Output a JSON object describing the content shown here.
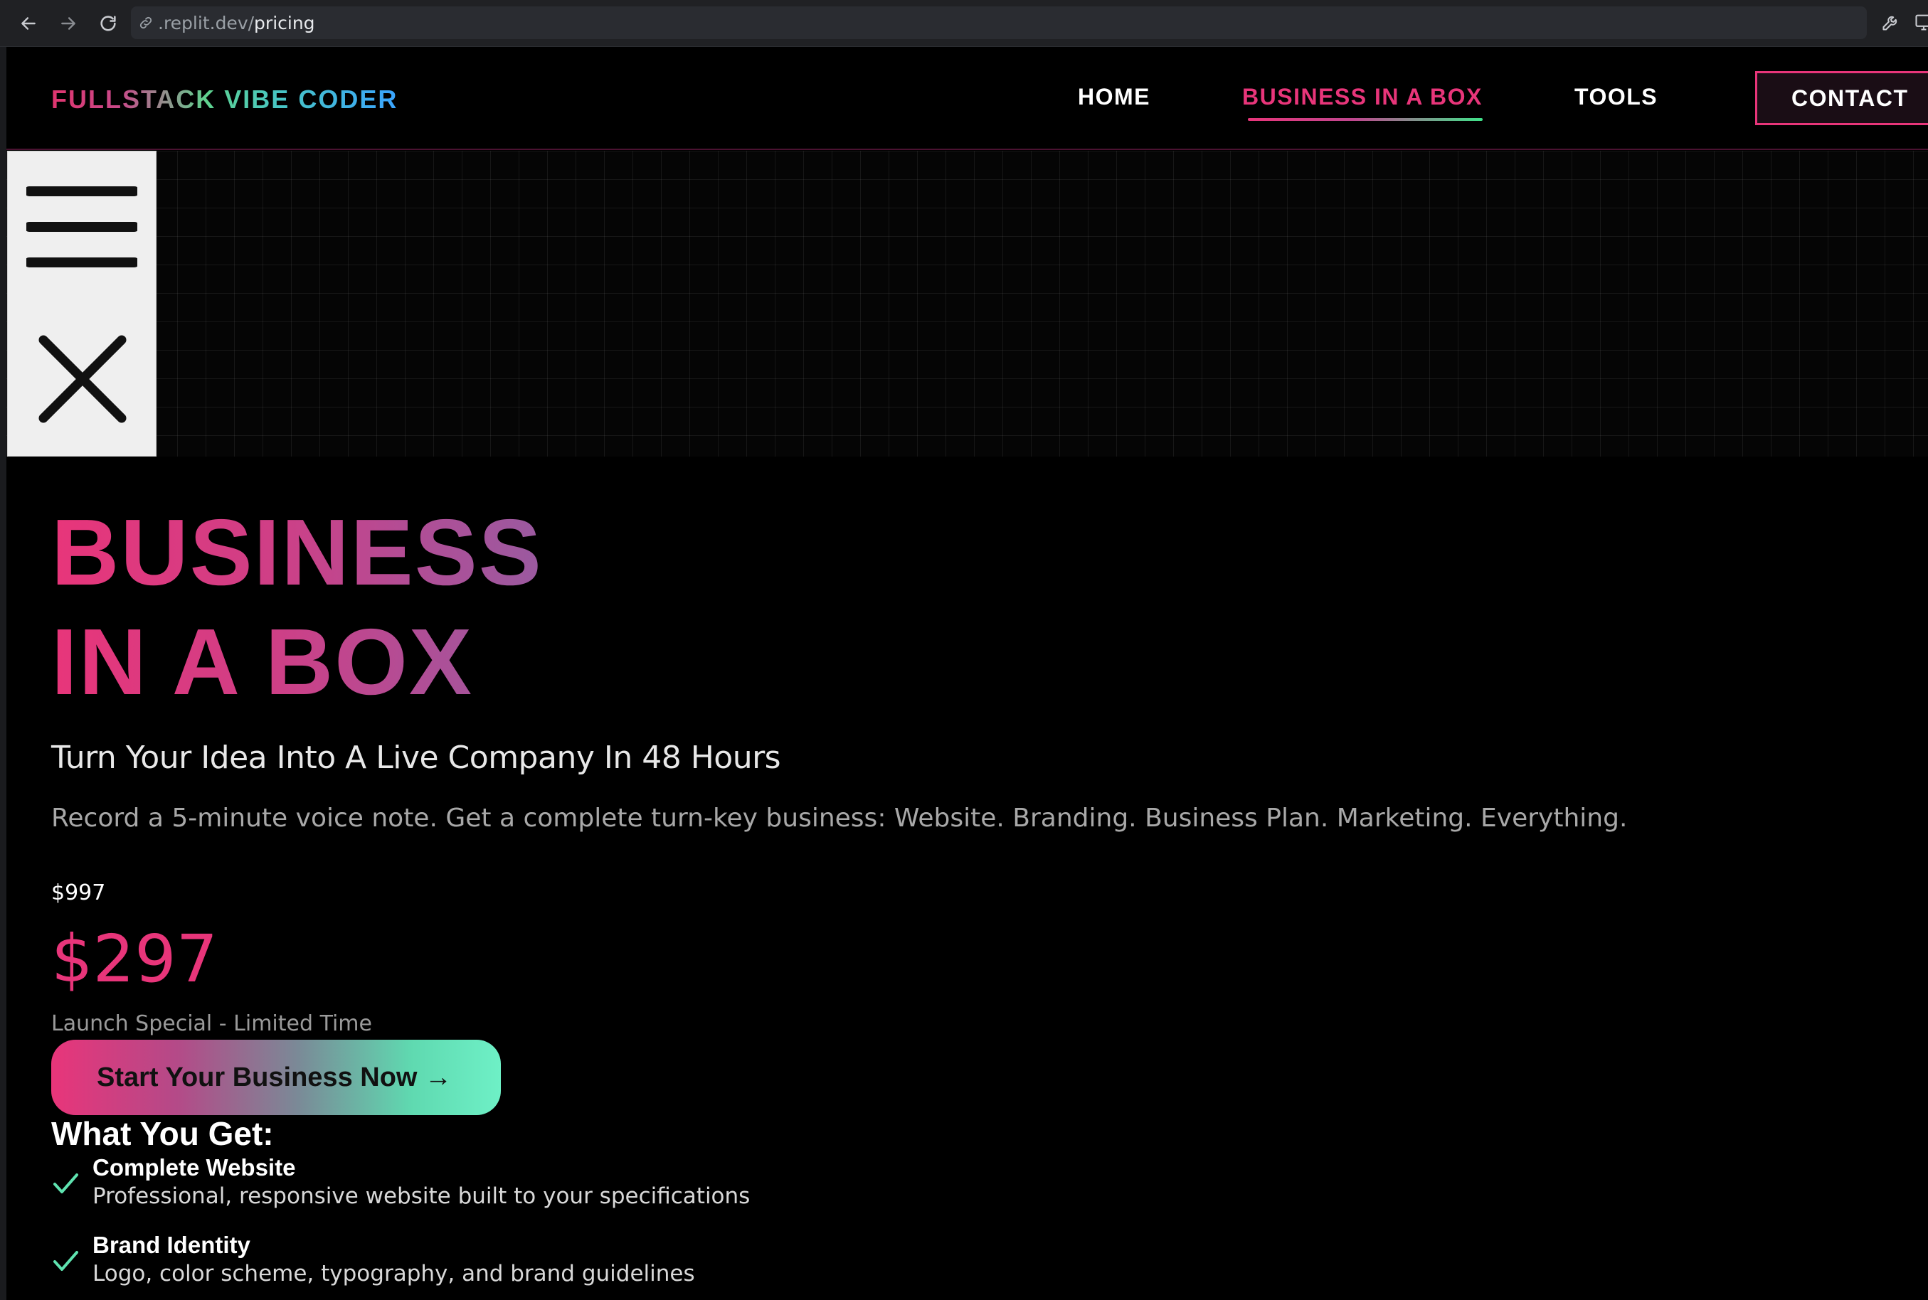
{
  "browser": {
    "url_domain": ".replit.dev/",
    "url_path": "pricing"
  },
  "header": {
    "logo": "FULLSTACK VIBE CODER",
    "nav": [
      {
        "label": "HOME"
      },
      {
        "label": "BUSINESS IN A BOX",
        "active": true
      },
      {
        "label": "TOOLS"
      }
    ],
    "contact_label": "CONTACT"
  },
  "colors": {
    "accent_pink": "#e8357a",
    "accent_green": "#3fe38a",
    "accent_mint": "#6ef0c6",
    "background": "#000000"
  },
  "menu_panel": {
    "icons": [
      "hamburger-icon",
      "close-icon"
    ]
  },
  "hero": {
    "title_line1": "BUSINESS",
    "title_line2": "IN A BOX",
    "tagline": "Turn Your Idea Into A Live Company In 48 Hours",
    "description": "Record a 5-minute voice note. Get a complete turn-key business: Website. Branding. Business Plan. Marketing. Everything."
  },
  "pricing": {
    "old_price": "$997",
    "new_price": "$297",
    "note": "Launch Special - Limited Time",
    "cta_label": "Start Your Business Now →"
  },
  "features": {
    "title": "What You Get:",
    "items": [
      {
        "title": "Complete Website",
        "description": "Professional, responsive website built to your specifications"
      },
      {
        "title": "Brand Identity",
        "description": "Logo, color scheme, typography, and brand guidelines"
      }
    ]
  }
}
